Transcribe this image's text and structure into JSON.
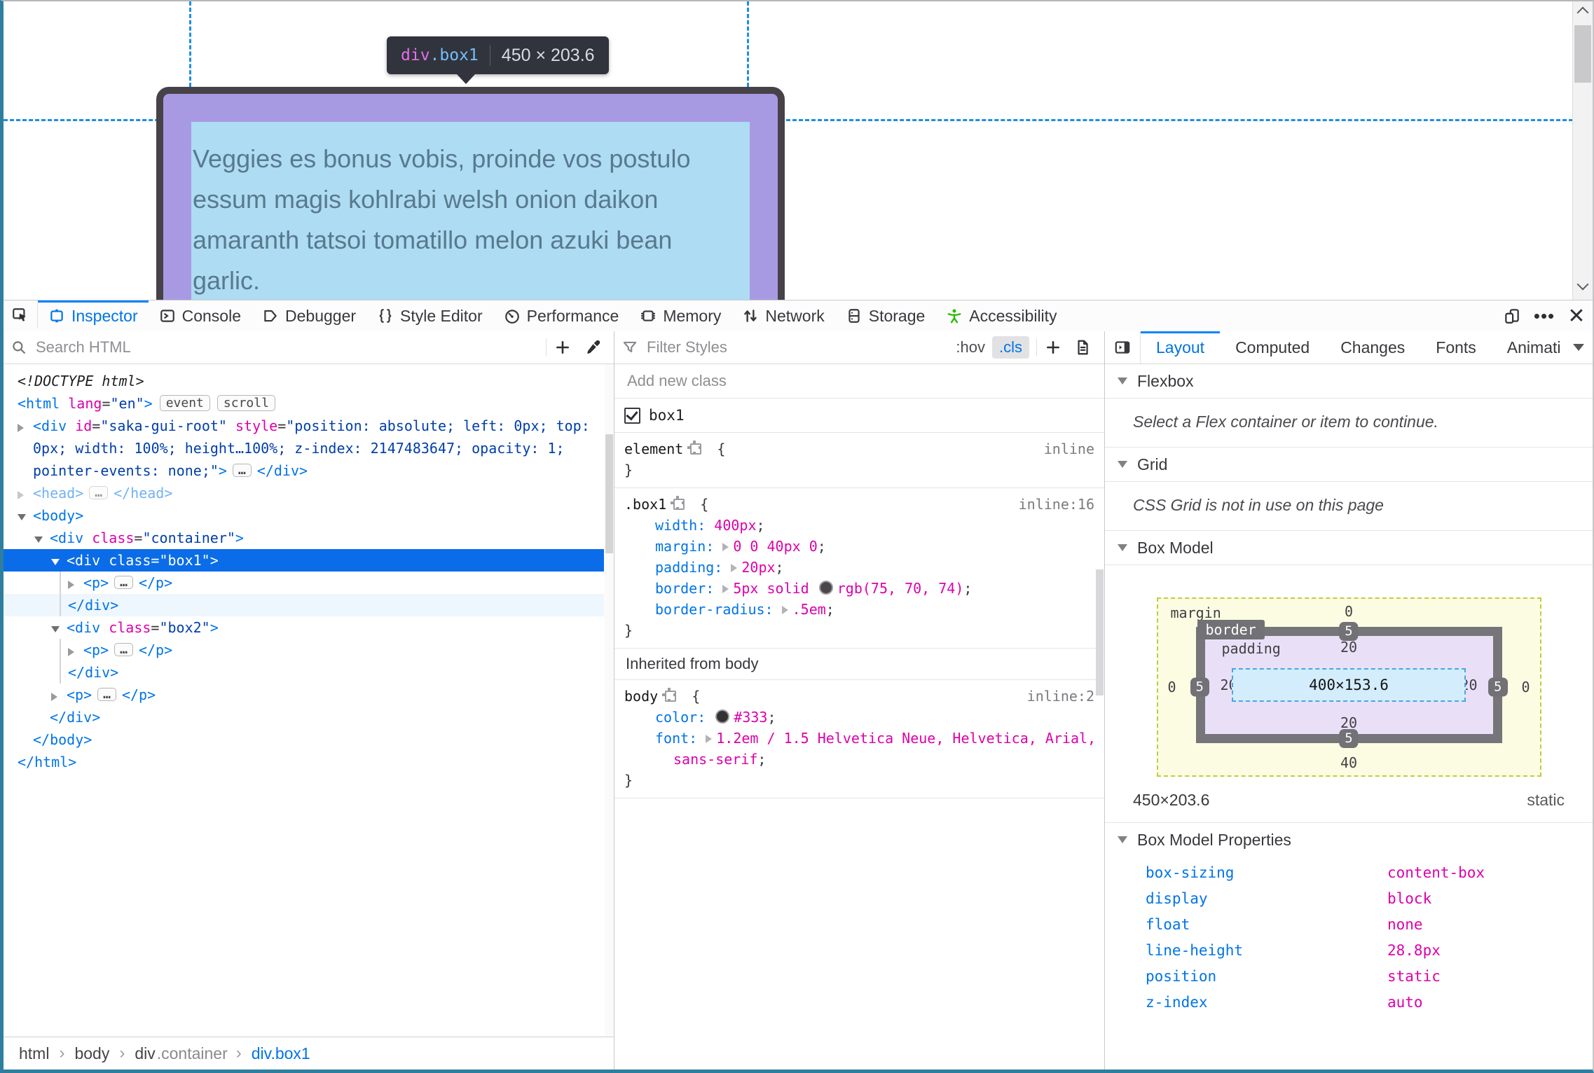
{
  "page": {
    "tooltip": {
      "tag": "div",
      "cls": ".box1",
      "size": "450 × 203.6"
    },
    "text_lines": [
      "Veggies es bonus vobis, proinde vos postulo",
      "essum magis kohlrabi welsh onion daikon",
      "amaranth tatsoi tomatillo melon azuki bean",
      "garlic."
    ]
  },
  "toolbar": {
    "tabs": [
      {
        "label": "Inspector"
      },
      {
        "label": "Console"
      },
      {
        "label": "Debugger"
      },
      {
        "label": "Style Editor"
      },
      {
        "label": "Performance"
      },
      {
        "label": "Memory"
      },
      {
        "label": "Network"
      },
      {
        "label": "Storage"
      },
      {
        "label": "Accessibility"
      }
    ]
  },
  "markup": {
    "search_placeholder": "Search HTML",
    "rows": [
      {
        "ind": 20,
        "nosp": 1,
        "tk": [
          {
            "t": "doctype",
            "s": "<!DOCTYPE html>"
          }
        ]
      },
      {
        "ind": 20,
        "nosp": 1,
        "tk": [
          {
            "t": "tag",
            "s": "<html"
          },
          {
            "t": "attr",
            "s": " lang"
          },
          {
            "t": "plain",
            "s": "="
          },
          {
            "t": "val",
            "s": "\"en\""
          },
          {
            "t": "tag",
            "s": ">"
          },
          {
            "t": "pill",
            "s": "event"
          },
          {
            "t": "pill",
            "s": "scroll"
          }
        ]
      },
      {
        "ind": 20,
        "arrow": "exp",
        "tk": [
          {
            "t": "tag",
            "s": "<div"
          },
          {
            "t": "attr",
            "s": " id"
          },
          {
            "t": "plain",
            "s": "="
          },
          {
            "t": "val",
            "s": "\"saka-gui-root\""
          },
          {
            "t": "attr",
            "s": " style"
          },
          {
            "t": "plain",
            "s": "="
          },
          {
            "t": "val",
            "s": "\"position: absolute; left: 0px; top:"
          }
        ]
      },
      {
        "ind": 42,
        "nosp": 1,
        "tk": [
          {
            "t": "val",
            "s": "0px; width: 100%; height…100%; z-index: 2147483647; opacity: 1;"
          }
        ]
      },
      {
        "ind": 42,
        "nosp": 1,
        "tk": [
          {
            "t": "val",
            "s": "pointer-events: none;\""
          },
          {
            "t": "tag",
            "s": ">"
          },
          {
            "t": "dots",
            "s": "…"
          },
          {
            "t": "tag",
            "s": "</div>"
          }
        ]
      },
      {
        "ind": 20,
        "arrow": "exp",
        "cls": "dim",
        "tk": [
          {
            "t": "tag",
            "s": "<head>"
          },
          {
            "t": "dots",
            "s": "…"
          },
          {
            "t": "tag",
            "s": "</head>"
          }
        ]
      },
      {
        "ind": 20,
        "arrow": "col",
        "tk": [
          {
            "t": "tag",
            "s": "<body>"
          }
        ]
      },
      {
        "ind": 44,
        "arrow": "col",
        "tk": [
          {
            "t": "tag",
            "s": "<div"
          },
          {
            "t": "attr",
            "s": " class"
          },
          {
            "t": "plain",
            "s": "="
          },
          {
            "t": "val",
            "s": "\"container\""
          },
          {
            "t": "tag",
            "s": ">"
          }
        ]
      },
      {
        "ind": 68,
        "arrow": "col",
        "cls": "sel",
        "tk": [
          {
            "t": "tag",
            "s": "<div"
          },
          {
            "t": "attr",
            "s": " class"
          },
          {
            "t": "plain",
            "s": "="
          },
          {
            "t": "val",
            "s": "\"box1\""
          },
          {
            "t": "tag",
            "s": ">"
          }
        ]
      },
      {
        "ind": 92,
        "arrow": "exp",
        "g": 80,
        "tk": [
          {
            "t": "tag",
            "s": "<p>"
          },
          {
            "t": "dots",
            "s": "…"
          },
          {
            "t": "tag",
            "s": "</p>"
          }
        ]
      },
      {
        "ind": 92,
        "nosp": 1,
        "g": 80,
        "cls": "tint",
        "tk": [
          {
            "t": "tag",
            "s": "</div>"
          }
        ]
      },
      {
        "ind": 68,
        "arrow": "col",
        "tk": [
          {
            "t": "tag",
            "s": "<div"
          },
          {
            "t": "attr",
            "s": " class"
          },
          {
            "t": "plain",
            "s": "="
          },
          {
            "t": "val",
            "s": "\"box2\""
          },
          {
            "t": "tag",
            "s": ">"
          }
        ]
      },
      {
        "ind": 92,
        "arrow": "exp",
        "g": 80,
        "tk": [
          {
            "t": "tag",
            "s": "<p>"
          },
          {
            "t": "dots",
            "s": "…"
          },
          {
            "t": "tag",
            "s": "</p>"
          }
        ]
      },
      {
        "ind": 92,
        "nosp": 1,
        "g": 80,
        "tk": [
          {
            "t": "tag",
            "s": "</div>"
          }
        ]
      },
      {
        "ind": 68,
        "arrow": "exp",
        "tk": [
          {
            "t": "tag",
            "s": "<p>"
          },
          {
            "t": "dots",
            "s": "…"
          },
          {
            "t": "tag",
            "s": "</p>"
          }
        ]
      },
      {
        "ind": 66,
        "nosp": 1,
        "tk": [
          {
            "t": "tag",
            "s": "</div>"
          }
        ]
      },
      {
        "ind": 42,
        "nosp": 1,
        "tk": [
          {
            "t": "tag",
            "s": "</body>"
          }
        ]
      },
      {
        "ind": 20,
        "nosp": 1,
        "tk": [
          {
            "t": "tag",
            "s": "</html>"
          }
        ]
      }
    ],
    "breadcrumb": [
      {
        "c": "dark",
        "s": "html"
      },
      {
        "c": "sep",
        "s": "›"
      },
      {
        "c": "dark",
        "s": "body"
      },
      {
        "c": "sep",
        "s": "›"
      },
      {
        "c": "dark",
        "s": "div"
      },
      {
        "c": "gray",
        "s": ".container"
      },
      {
        "c": "sep",
        "s": "›"
      },
      {
        "c": "blue",
        "s": "div.box1"
      }
    ]
  },
  "rules": {
    "filter_placeholder": "Filter Styles",
    "hov": ":hov",
    "cls": ".cls",
    "add_class_placeholder": "Add new class",
    "class_name": "box1",
    "element_rule": {
      "loc": "inline",
      "sel": [
        {
          "t": "sel",
          "s": "element"
        },
        {
          "t": "xh"
        },
        {
          "t": "plain",
          "s": " {"
        }
      ],
      "close": [
        {
          "t": "plain",
          "s": "}"
        }
      ]
    },
    "box1_rule": {
      "loc": "inline:16",
      "sel": [
        {
          "t": "sel",
          "s": ".box1"
        },
        {
          "t": "xh"
        },
        {
          "t": "plain",
          "s": " {"
        }
      ],
      "lines": [
        {
          "tk": [
            {
              "t": "prop",
              "s": "width: "
            },
            {
              "t": "value",
              "s": "400px"
            },
            {
              "t": "plain",
              "s": ";"
            }
          ]
        },
        {
          "tk": [
            {
              "t": "prop",
              "s": "margin: "
            },
            {
              "t": "exp"
            },
            {
              "t": "value",
              "s": "0 0 40px 0"
            },
            {
              "t": "plain",
              "s": ";"
            }
          ]
        },
        {
          "tk": [
            {
              "t": "prop",
              "s": "padding: "
            },
            {
              "t": "exp"
            },
            {
              "t": "value",
              "s": "20px"
            },
            {
              "t": "plain",
              "s": ";"
            }
          ]
        },
        {
          "tk": [
            {
              "t": "prop",
              "s": "border: "
            },
            {
              "t": "exp"
            },
            {
              "t": "value",
              "s": "5px solid "
            },
            {
              "t": "swatch",
              "c": "#4b464a"
            },
            {
              "t": "value",
              "s": "rgb(75, 70, 74)"
            },
            {
              "t": "plain",
              "s": ";"
            }
          ]
        },
        {
          "tk": [
            {
              "t": "prop",
              "s": "border-radius: "
            },
            {
              "t": "exp"
            },
            {
              "t": "value",
              "s": ".5em"
            },
            {
              "t": "plain",
              "s": ";"
            }
          ]
        }
      ],
      "close": [
        {
          "t": "plain",
          "s": "}"
        }
      ]
    },
    "inherited_label": "Inherited from body",
    "body_rule": {
      "loc": "inline:2",
      "sel": [
        {
          "t": "sel",
          "s": "body"
        },
        {
          "t": "xh"
        },
        {
          "t": "plain",
          "s": " {"
        }
      ],
      "lines": [
        {
          "tk": [
            {
              "t": "prop",
              "s": "color: "
            },
            {
              "t": "swatch",
              "c": "#333333"
            },
            {
              "t": "value",
              "s": "#333"
            },
            {
              "t": "plain",
              "s": ";"
            }
          ]
        },
        {
          "tk": [
            {
              "t": "prop",
              "s": "font: "
            },
            {
              "t": "exp"
            },
            {
              "t": "value",
              "s": "1.2em / 1.5 Helvetica Neue, Helvetica, Arial,"
            }
          ]
        },
        {
          "tk": [
            {
              "t": "value",
              "s": "sans-serif"
            },
            {
              "t": "plain",
              "s": ";"
            }
          ]
        }
      ],
      "close": [
        {
          "t": "plain",
          "s": "}"
        }
      ]
    }
  },
  "layout": {
    "tabs": [
      {
        "label": "Layout"
      },
      {
        "label": "Computed"
      },
      {
        "label": "Changes"
      },
      {
        "label": "Fonts"
      },
      {
        "label": "Animati"
      }
    ],
    "flexbox": {
      "title": "Flexbox",
      "message": "Select a Flex container or item to continue."
    },
    "grid": {
      "title": "Grid",
      "message": "CSS Grid is not in use on this page"
    },
    "box_model": {
      "title": "Box Model",
      "labels": {
        "margin": "margin",
        "border": "border",
        "padding": "padding"
      },
      "margin": {
        "top": "0",
        "right": "0",
        "bottom": "40",
        "left": "0"
      },
      "border": {
        "top": "5",
        "right": "5",
        "bottom": "5",
        "left": "5"
      },
      "padding": {
        "top": "20",
        "right": "20",
        "bottom": "20",
        "left": "20"
      },
      "content": "400×153.6",
      "dimensions": "450×203.6",
      "position": "static",
      "props_title": "Box Model Properties",
      "properties": [
        {
          "name": "box-sizing",
          "value": "content-box"
        },
        {
          "name": "display",
          "value": "block"
        },
        {
          "name": "float",
          "value": "none"
        },
        {
          "name": "line-height",
          "value": "28.8px"
        },
        {
          "name": "position",
          "value": "static"
        },
        {
          "name": "z-index",
          "value": "auto"
        }
      ]
    }
  }
}
